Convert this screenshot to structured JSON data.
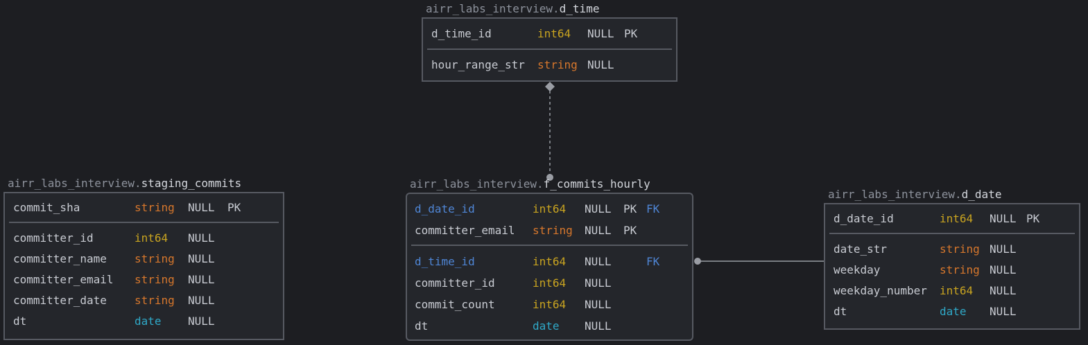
{
  "tables": {
    "d_time": {
      "schema": "airr_labs_interview.",
      "name": "d_time",
      "key_columns": [
        {
          "name": "d_time_id",
          "type": "int64",
          "null": "NULL",
          "pk": "PK",
          "fk": "",
          "is_fk": false
        }
      ],
      "columns": [
        {
          "name": "hour_range_str",
          "type": "string",
          "null": "NULL",
          "pk": "",
          "fk": "",
          "is_fk": false
        }
      ]
    },
    "staging_commits": {
      "schema": "airr_labs_interview.",
      "name": "staging_commits",
      "key_columns": [
        {
          "name": "commit_sha",
          "type": "string",
          "null": "NULL",
          "pk": "PK",
          "fk": "",
          "is_fk": false
        }
      ],
      "columns": [
        {
          "name": "committer_id",
          "type": "int64",
          "null": "NULL",
          "pk": "",
          "fk": "",
          "is_fk": false
        },
        {
          "name": "committer_name",
          "type": "string",
          "null": "NULL",
          "pk": "",
          "fk": "",
          "is_fk": false
        },
        {
          "name": "committer_email",
          "type": "string",
          "null": "NULL",
          "pk": "",
          "fk": "",
          "is_fk": false
        },
        {
          "name": "committer_date",
          "type": "string",
          "null": "NULL",
          "pk": "",
          "fk": "",
          "is_fk": false
        },
        {
          "name": "dt",
          "type": "date",
          "null": "NULL",
          "pk": "",
          "fk": "",
          "is_fk": false
        }
      ]
    },
    "f_commits_hourly": {
      "schema": "airr_labs_interview.",
      "name": "f_commits_hourly",
      "key_columns": [
        {
          "name": "d_date_id",
          "type": "int64",
          "null": "NULL",
          "pk": "PK",
          "fk": "FK",
          "is_fk": true
        },
        {
          "name": "committer_email",
          "type": "string",
          "null": "NULL",
          "pk": "PK",
          "fk": "",
          "is_fk": false
        }
      ],
      "columns": [
        {
          "name": "d_time_id",
          "type": "int64",
          "null": "NULL",
          "pk": "",
          "fk": "FK",
          "is_fk": true
        },
        {
          "name": "committer_id",
          "type": "int64",
          "null": "NULL",
          "pk": "",
          "fk": "",
          "is_fk": false
        },
        {
          "name": "commit_count",
          "type": "int64",
          "null": "NULL",
          "pk": "",
          "fk": "",
          "is_fk": false
        },
        {
          "name": "dt",
          "type": "date",
          "null": "NULL",
          "pk": "",
          "fk": "",
          "is_fk": false
        }
      ]
    },
    "d_date": {
      "schema": "airr_labs_interview.",
      "name": "d_date",
      "key_columns": [
        {
          "name": "d_date_id",
          "type": "int64",
          "null": "NULL",
          "pk": "PK",
          "fk": "",
          "is_fk": false
        }
      ],
      "columns": [
        {
          "name": "date_str",
          "type": "string",
          "null": "NULL",
          "pk": "",
          "fk": "",
          "is_fk": false
        },
        {
          "name": "weekday",
          "type": "string",
          "null": "NULL",
          "pk": "",
          "fk": "",
          "is_fk": false
        },
        {
          "name": "weekday_number",
          "type": "int64",
          "null": "NULL",
          "pk": "",
          "fk": "",
          "is_fk": false
        },
        {
          "name": "dt",
          "type": "date",
          "null": "NULL",
          "pk": "",
          "fk": "",
          "is_fk": false
        }
      ]
    }
  },
  "relationships": [
    {
      "from": "f_commits_hourly.d_time_id",
      "to": "d_time.d_time_id",
      "style": "dashed"
    },
    {
      "from": "f_commits_hourly.d_date_id",
      "to": "d_date.d_date_id",
      "style": "solid"
    }
  ],
  "colors": {
    "background": "#1d1e22",
    "border": "#575a62",
    "int64": "#c9a420",
    "string": "#d7772c",
    "date": "#2fa9c8",
    "fk": "#4f86d6",
    "connector": "#9a9da4"
  }
}
